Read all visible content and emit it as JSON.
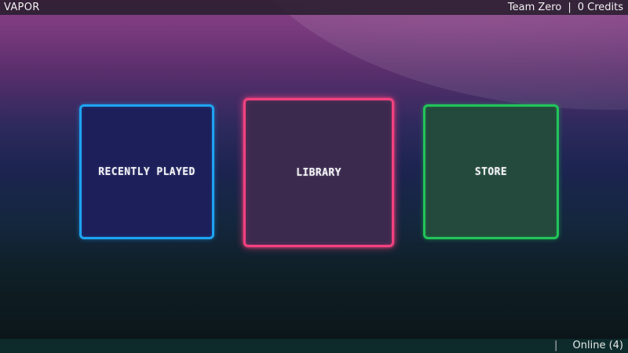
{
  "topbar": {
    "brand": "VAPOR",
    "username": "Team Zero",
    "separator": "|",
    "credits": "0 Credits"
  },
  "tiles": {
    "recent": {
      "label": "RECENTLY PLAYED",
      "color": "#1fa3f2"
    },
    "library": {
      "label": "LIBRARY",
      "color": "#f2417f"
    },
    "store": {
      "label": "STORE",
      "color": "#22c45a"
    }
  },
  "bottombar": {
    "separator": "|",
    "online": "Online (4)"
  }
}
